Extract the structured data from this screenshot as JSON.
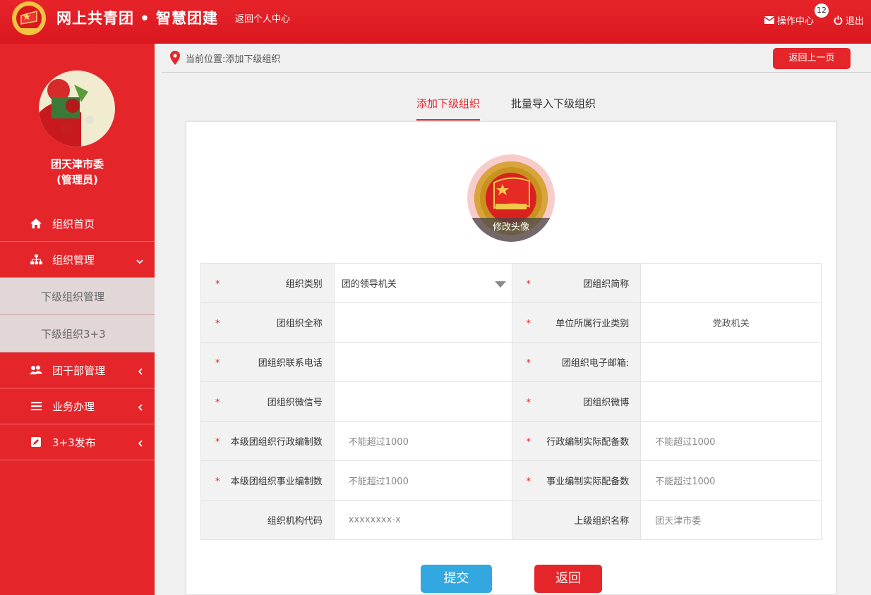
{
  "header": {
    "brand": "网上共青团 • 智慧团建",
    "back_personal": "返回个人中心",
    "ops_label": "操作中心",
    "ops_badge": "12",
    "logout_label": "退出"
  },
  "sidebar": {
    "user_name": "团天津市委",
    "user_role": "(管理员)",
    "items": [
      {
        "label": "组织首页",
        "icon": "home-icon"
      },
      {
        "label": "组织管理",
        "icon": "org-tree-icon"
      },
      {
        "label": "下级组织管理"
      },
      {
        "label": "下级组织3+3"
      },
      {
        "label": "团干部管理",
        "icon": "users-icon"
      },
      {
        "label": "业务办理",
        "icon": "list-icon"
      },
      {
        "label": "3+3发布",
        "icon": "edit-icon"
      }
    ]
  },
  "breadcrumb": {
    "text": "当前位置:添加下级组织",
    "back_label": "返回上一页"
  },
  "tabs": [
    {
      "label": "添加下级组织"
    },
    {
      "label": "批量导入下级组织"
    }
  ],
  "avatar": {
    "change_label": "修改头像"
  },
  "form": {
    "rows": [
      {
        "l1": "组织类别",
        "v1": "团的领导机关",
        "l2": "团组织简称",
        "v2": ""
      },
      {
        "l1": "团组织全称",
        "v1": "",
        "l2": "单位所属行业类别",
        "v2": "党政机关"
      },
      {
        "l1": "团组织联系电话",
        "v1": "",
        "l2": "团组织电子邮箱:",
        "v2": ""
      },
      {
        "l1": "团组织微信号",
        "v1": "",
        "l2": "团组织微博",
        "v2": ""
      },
      {
        "l1": "本级团组织行政编制数",
        "v1": "不能超过1000",
        "l2": "行政编制实际配备数",
        "v2": "不能超过1000"
      },
      {
        "l1": "本级团组织事业编制数",
        "v1": "不能超过1000",
        "l2": "事业编制实际配备数",
        "v2": "不能超过1000"
      },
      {
        "l1": "组织机构代码",
        "v1": "xxxxxxxx-x",
        "l2": "上级组织名称",
        "v2": "团天津市委"
      }
    ],
    "required_mark": "*"
  },
  "buttons": {
    "submit": "提交",
    "back": "返回"
  },
  "colors": {
    "primary_red": "#e4262b",
    "submit_blue": "#33a8e0"
  }
}
